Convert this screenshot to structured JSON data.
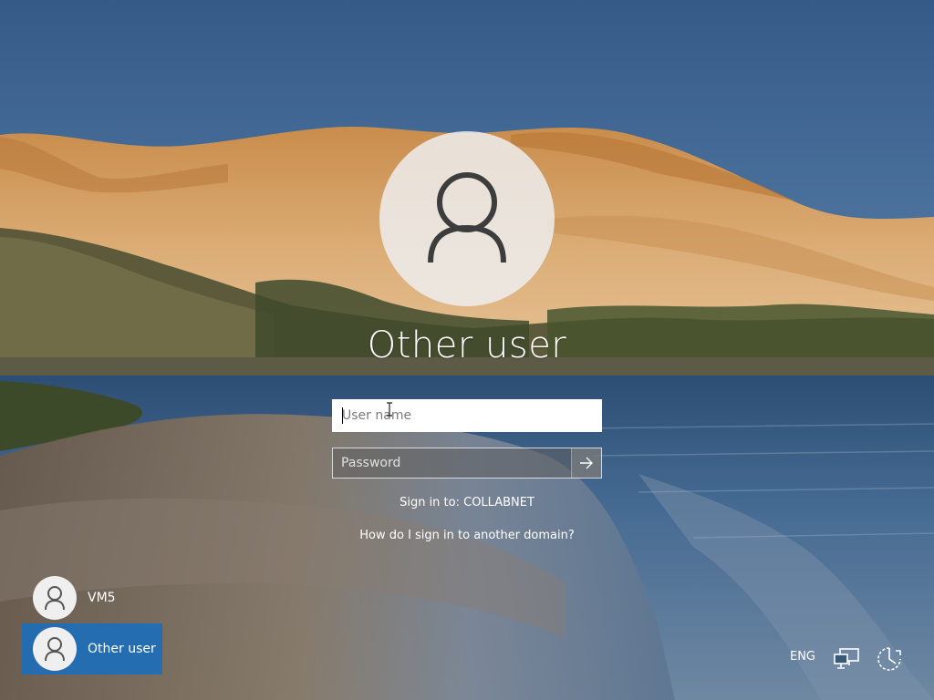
{
  "user": {
    "name": "Other user"
  },
  "form": {
    "username_placeholder": "User name",
    "password_placeholder": "Password",
    "sign_in_to": "Sign in to: COLLABNET",
    "other_domain_link": "How do I sign in to another domain?"
  },
  "user_list": [
    {
      "name": "VM5",
      "selected": false
    },
    {
      "name": "Other user",
      "selected": true
    }
  ],
  "tray": {
    "language": "ENG",
    "icons": [
      "network-icon",
      "ease-of-access-icon",
      "power-icon"
    ]
  },
  "colors": {
    "sky": "#3f6696",
    "dune": "#d8a56d",
    "selected_tile": "#1e6eb9",
    "text": "#ffffff"
  }
}
